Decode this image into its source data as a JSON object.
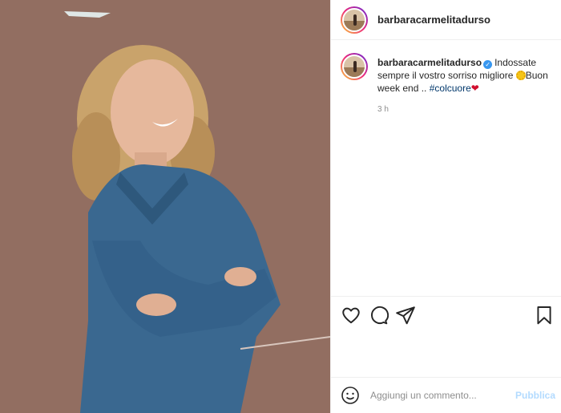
{
  "post": {
    "username": "barbaracarmelitadurso",
    "verified": true,
    "photo_description_icon": "photo-icon"
  },
  "caption": {
    "username": "barbaracarmelitadurso",
    "text_part1": "Indossate sempre il vostro sorriso migliore ",
    "emoji_sun": "sun-emoji",
    "text_part2": "Buon week end .. ",
    "hashtag": "#colcuore",
    "heart": "❤",
    "time": "3 h"
  },
  "actions": {
    "like_icon": "heart-icon",
    "comment_icon": "comment-icon",
    "share_icon": "paper-plane-icon",
    "save_icon": "bookmark-icon"
  },
  "comment_box": {
    "placeholder": "Aggiungi un commento...",
    "publish_label": "Pubblica",
    "emoji_icon": "smiley-icon"
  },
  "colors": {
    "link": "#00376b",
    "verified": "#3897f0",
    "publish_disabled": "#b3dbff",
    "heart": "#d10f2f",
    "muted": "#8e8e8e"
  }
}
